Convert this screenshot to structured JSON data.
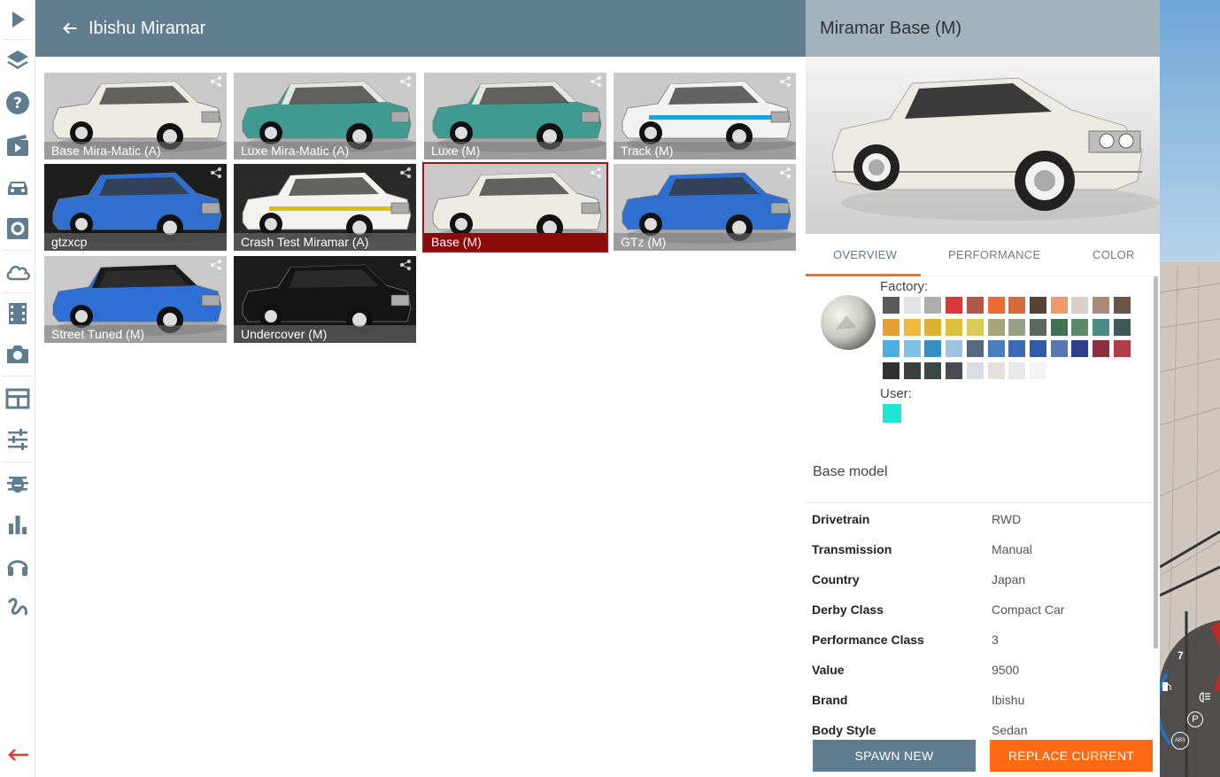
{
  "header": {
    "title": "Ibishu Miramar",
    "back_icon": "arrow-left-icon"
  },
  "sidebar": {
    "items": [
      {
        "name": "play-icon"
      },
      {
        "name": "layers-icon"
      },
      {
        "name": "help-icon"
      },
      {
        "name": "scenario-icon"
      },
      {
        "name": "vehicles-icon"
      },
      {
        "name": "vehicle-config-icon"
      },
      {
        "name": "cloud-icon"
      },
      {
        "name": "replay-icon"
      },
      {
        "name": "camera-icon"
      },
      {
        "name": "apps-icon"
      },
      {
        "name": "options-icon"
      },
      {
        "name": "debug-icon"
      },
      {
        "name": "performance-icon"
      },
      {
        "name": "audio-icon"
      },
      {
        "name": "drive-path-icon"
      }
    ],
    "exit_icon": "exit-arrow-icon"
  },
  "configs": [
    {
      "label": "Base Mira-Matic (A)",
      "body": "#ecebe3",
      "roof": "#ecebe3",
      "bg": "#c9c9c9",
      "stripe": "",
      "selected": false
    },
    {
      "label": "Luxe Mira-Matic (A)",
      "body": "#3f9a92",
      "roof": "#e6e6e1",
      "bg": "#c9c9c9",
      "stripe": "",
      "selected": false
    },
    {
      "label": "Luxe (M)",
      "body": "#3f9a92",
      "roof": "#e6e6e1",
      "bg": "#c9c9c9",
      "stripe": "",
      "selected": false
    },
    {
      "label": "Track (M)",
      "body": "#f2f2f2",
      "roof": "#f2f2f2",
      "bg": "#c9c9c9",
      "stripe": "#1fa3dd",
      "selected": false
    },
    {
      "label": "gtzxcp",
      "body": "#2f6fd0",
      "roof": "#2f6fd0",
      "bg": "#1e1e1e",
      "stripe": "",
      "selected": false
    },
    {
      "label": "Crash Test Miramar (A)",
      "body": "#f2f2f0",
      "roof": "#f2f2f0",
      "bg": "#2a2a2a",
      "stripe": "#d8c21c",
      "selected": false
    },
    {
      "label": "Base (M)",
      "body": "#ecebe3",
      "roof": "#ecebe3",
      "bg": "#c9c9c9",
      "stripe": "",
      "selected": true
    },
    {
      "label": "GTz (M)",
      "body": "#2f6fd0",
      "roof": "#2f6fd0",
      "bg": "#c9c9c9",
      "stripe": "",
      "selected": false
    },
    {
      "label": "Street Tuned (M)",
      "body": "#2e6fd6",
      "roof": "#1b1b1b",
      "bg": "#c9c9c9",
      "stripe": "",
      "selected": false
    },
    {
      "label": "Undercover (M)",
      "body": "#151515",
      "roof": "#151515",
      "bg": "#1c1c1c",
      "stripe": "",
      "selected": false
    }
  ],
  "panel": {
    "title": "Miramar Base (M)",
    "tabs": [
      {
        "label": "OVERVIEW",
        "active": true
      },
      {
        "label": "PERFORMANCE",
        "active": false
      },
      {
        "label": "COLOR",
        "active": false
      }
    ],
    "factory_label": "Factory:",
    "user_label": "User:",
    "factory_colors": [
      "#5a5a5a",
      "#e3e3e3",
      "#aeaeae",
      "#d8383a",
      "#b0584a",
      "#ec6a34",
      "#d86a3c",
      "#5a4236",
      "#f0986a",
      "#dad0cc",
      "#a88a78",
      "#6a5446",
      "#e8a034",
      "#f0b83c",
      "#e0b030",
      "#dcc03a",
      "#d8cc58",
      "#a8a478",
      "#98a088",
      "#5a6a5e",
      "#3e7250",
      "#5a8a6a",
      "#4c8a84",
      "#3c5a58",
      "#4aaee0",
      "#7ec0e6",
      "#3890c0",
      "#9ec4e0",
      "#56687e",
      "#4a7cc0",
      "#3a6ab8",
      "#2e5ca8",
      "#5a76b0",
      "#2e3e88",
      "#8a3040",
      "#b03c4a",
      "#303030",
      "#3a4040",
      "#3a4a40",
      "#4a4a56",
      "#d8dce4",
      "#e4e0dc",
      "#e8e8e8",
      "#f4f4f4"
    ],
    "user_colors": [
      "#1de8d4"
    ],
    "base_model_label": "Base model",
    "specs": [
      {
        "key": "Drivetrain",
        "value": "RWD"
      },
      {
        "key": "Transmission",
        "value": "Manual"
      },
      {
        "key": "Country",
        "value": "Japan"
      },
      {
        "key": "Derby Class",
        "value": "Compact Car"
      },
      {
        "key": "Performance Class",
        "value": "3"
      },
      {
        "key": "Value",
        "value": "9500"
      },
      {
        "key": "Brand",
        "value": "Ibishu"
      },
      {
        "key": "Body Style",
        "value": "Sedan"
      }
    ],
    "spawn_label": "SPAWN NEW",
    "replace_label": "REPLACE CURRENT"
  },
  "hud": {
    "gear": "7",
    "park": "P",
    "abs": "ABS"
  },
  "colors": {
    "accent": "#ff6a13",
    "header": "#5f7d8e",
    "panel_header": "#a3b3bc",
    "selected": "#8d0a0a"
  }
}
